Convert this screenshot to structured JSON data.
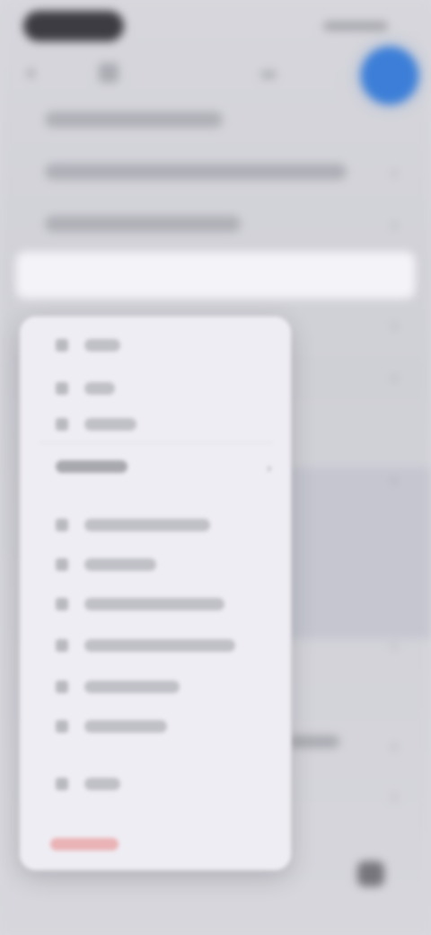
{
  "status_bar": {
    "time": "",
    "indicators": ""
  },
  "nav": {
    "back_icon": "chevron-left-icon",
    "title": "",
    "avatar_color": "#3d7fd8"
  },
  "background_rows": [
    {
      "label": ""
    },
    {
      "label": ""
    },
    {
      "label": ""
    }
  ],
  "popover": {
    "top_items": [
      {
        "icon": "square-icon",
        "label": ""
      },
      {
        "icon": "square-icon",
        "label": ""
      },
      {
        "icon": "square-icon",
        "label": ""
      }
    ],
    "section_label": "",
    "section_icon": "chevron-right-icon",
    "items": [
      {
        "icon": "square-icon",
        "label": ""
      },
      {
        "icon": "square-icon",
        "label": ""
      },
      {
        "icon": "square-icon",
        "label": ""
      },
      {
        "icon": "square-icon",
        "label": ""
      },
      {
        "icon": "square-icon",
        "label": ""
      },
      {
        "icon": "square-icon",
        "label": ""
      },
      {
        "icon": "square-icon",
        "label": ""
      }
    ],
    "destructive_label": "",
    "destructive_color": "#e89a9a"
  }
}
